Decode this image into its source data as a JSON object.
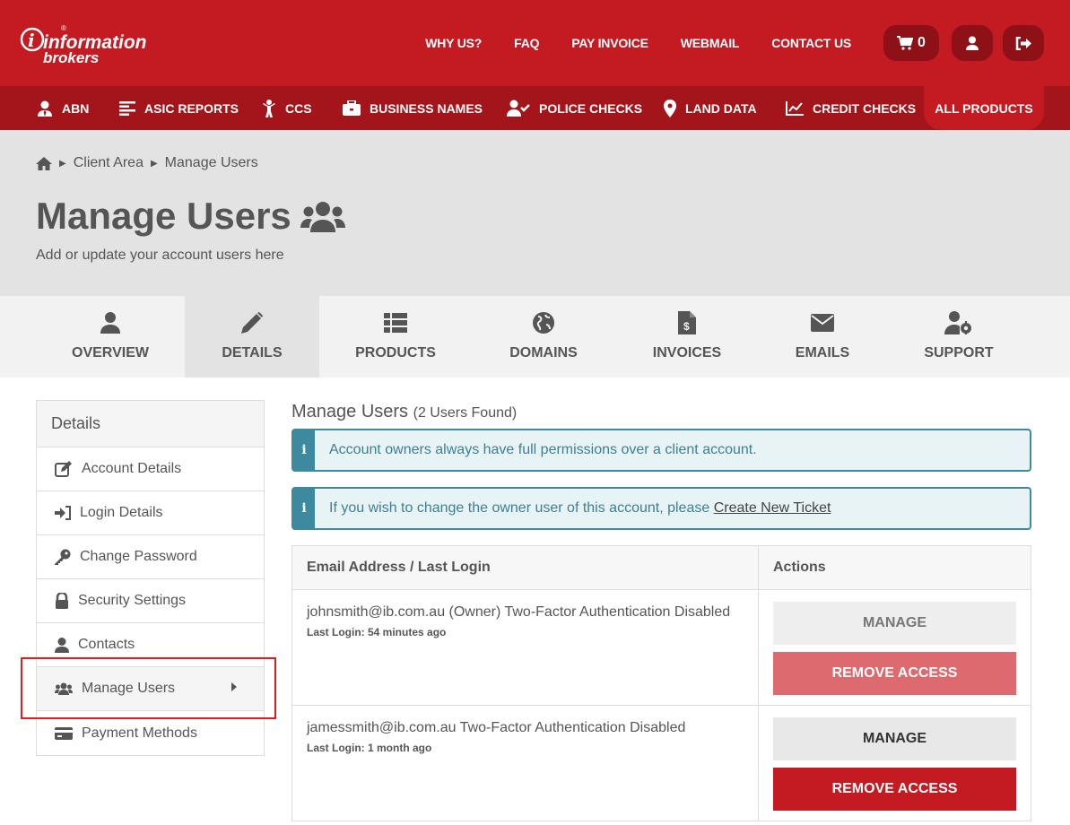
{
  "brand": {
    "line1": "information",
    "line2": "brokers",
    "primary": "#c41a22",
    "dark": "#a3151b"
  },
  "topnav": {
    "items": [
      "WHY US?",
      "FAQ",
      "PAY INVOICE",
      "WEBMAIL",
      "CONTACT US"
    ],
    "cart_count": "0"
  },
  "products": {
    "items": [
      {
        "label": "ABN",
        "icon": "user-tie-icon"
      },
      {
        "label": "ASIC REPORTS",
        "icon": "align-left-icon"
      },
      {
        "label": "CCS",
        "icon": "child-icon"
      },
      {
        "label": "BUSINESS NAMES",
        "icon": "briefcase-icon"
      },
      {
        "label": "POLICE CHECKS",
        "icon": "user-check-icon"
      },
      {
        "label": "LAND DATA",
        "icon": "map-marker-icon"
      },
      {
        "label": "CREDIT CHECKS",
        "icon": "chart-line-icon"
      }
    ],
    "all_label": "ALL PRODUCTS"
  },
  "breadcrumb": {
    "items": [
      "Client Area",
      "Manage Users"
    ]
  },
  "page": {
    "title": "Manage Users",
    "subtitle": "Add or update your account users here"
  },
  "tabs": [
    {
      "label": "OVERVIEW",
      "icon": "user-icon"
    },
    {
      "label": "DETAILS",
      "icon": "pencil-icon",
      "active": true
    },
    {
      "label": "PRODUCTS",
      "icon": "list-icon"
    },
    {
      "label": "DOMAINS",
      "icon": "globe-icon"
    },
    {
      "label": "INVOICES",
      "icon": "file-invoice-icon"
    },
    {
      "label": "EMAILS",
      "icon": "envelope-icon"
    },
    {
      "label": "SUPPORT",
      "icon": "user-cog-icon"
    }
  ],
  "sidebar": {
    "title": "Details",
    "items": [
      {
        "label": "Account Details",
        "icon": "edit-icon"
      },
      {
        "label": "Login Details",
        "icon": "sign-in-icon"
      },
      {
        "label": "Change Password",
        "icon": "key-icon"
      },
      {
        "label": "Security Settings",
        "icon": "lock-icon"
      },
      {
        "label": "Contacts",
        "icon": "user-icon"
      },
      {
        "label": "Manage Users",
        "icon": "users-icon",
        "active": true
      },
      {
        "label": "Payment Methods",
        "icon": "credit-card-icon"
      }
    ]
  },
  "main": {
    "title": "Manage Users",
    "count": "(2 Users Found)",
    "alerts": [
      {
        "text": "Account owners always have full permissions over a client account."
      },
      {
        "text": "If you wish to change the owner user of this account, please ",
        "link": "Create New Ticket"
      }
    ],
    "table": {
      "headers": [
        "Email Address / Last Login",
        "Actions"
      ],
      "rows": [
        {
          "email": "johnsmith@ib.com.au (Owner) Two-Factor Authentication Disabled",
          "login": "Last Login: 54 minutes ago",
          "manage": "MANAGE",
          "remove": "REMOVE ACCESS"
        },
        {
          "email": "jamessmith@ib.com.au Two-Factor Authentication Disabled",
          "login": "Last Login: 1 month ago",
          "manage": "MANAGE",
          "remove": "REMOVE ACCESS"
        }
      ]
    }
  }
}
